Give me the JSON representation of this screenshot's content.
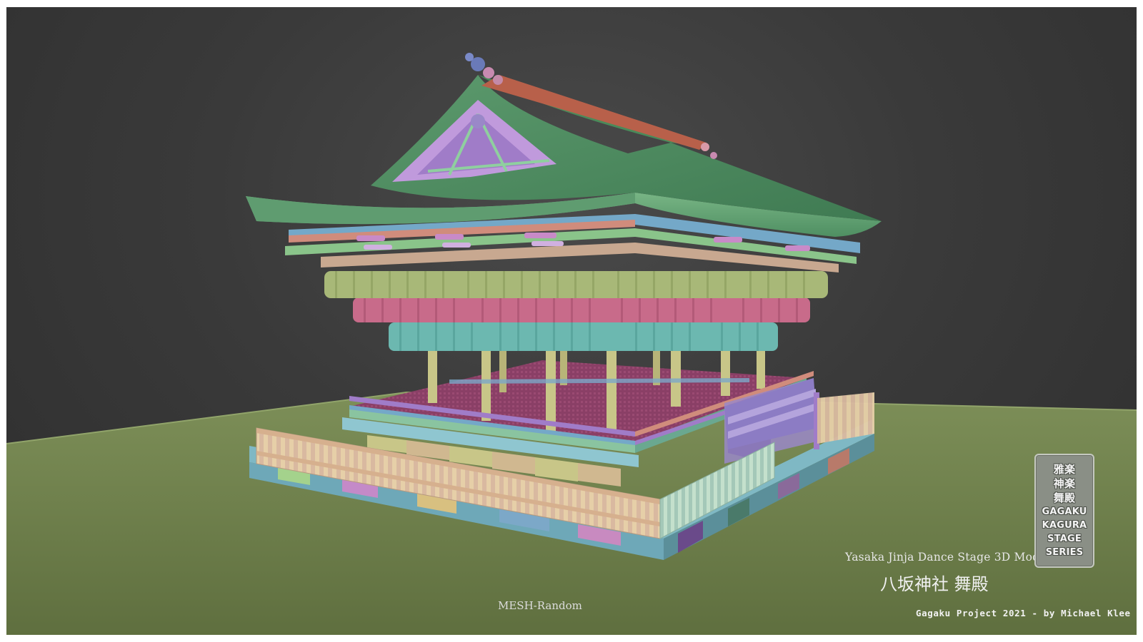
{
  "viewport": {
    "background_color": "#363636",
    "ground_color": "#6f7f4c",
    "shading_mode": "MESH-Random"
  },
  "model": {
    "title": "Yasaka Jinja Dance Stage 3D Model",
    "title_jp": "八坂神社 舞殿",
    "credit": "Gagaku Project 2021 - by Michael Klee"
  },
  "series_badge": {
    "lines": [
      "雅楽",
      "神楽",
      "舞殿",
      "GAGAKU",
      "KAGURA",
      "STAGE",
      "SERIES"
    ]
  },
  "palette": {
    "roof": "#6aa878",
    "lantern_green": "#a8b878",
    "lantern_pink": "#c86b8a",
    "lantern_teal": "#6cb8b0",
    "pillar": "#c8c688",
    "purple": "#a07cc8",
    "blue": "#74a8c8",
    "salmon": "#d08c7c"
  },
  "icons": [
    "pavilion-model"
  ]
}
